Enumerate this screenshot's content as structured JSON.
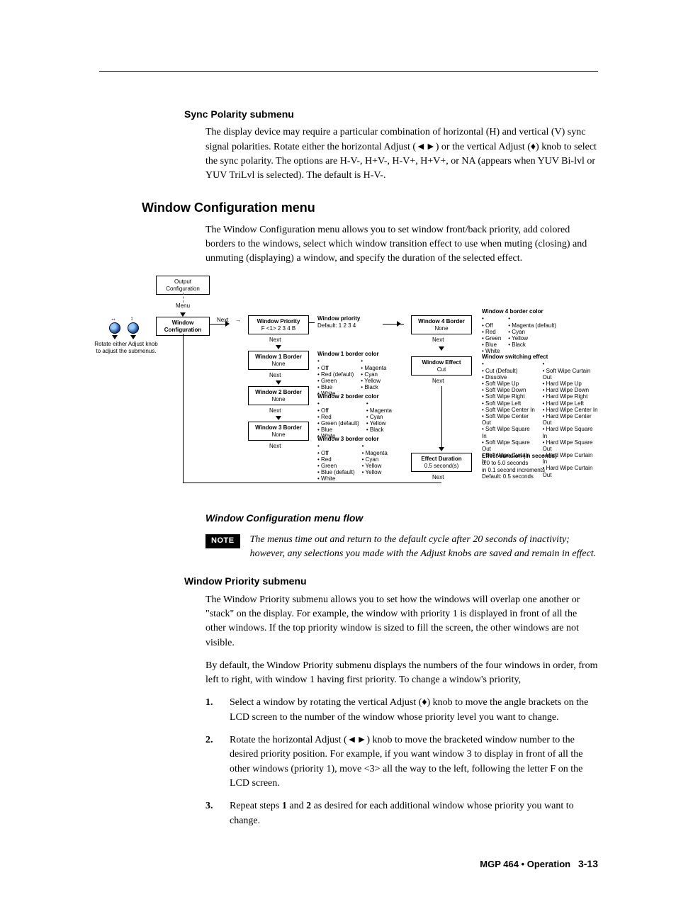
{
  "sync": {
    "heading": "Sync Polarity submenu",
    "p1": "The display device may require a particular combination of horizontal (H) and vertical (V) sync signal polarities.  Rotate either the horizontal Adjust (◄►) or the vertical Adjust (♦) knob to select the sync polarity.  The options are H-V-, H+V-, H-V+, H+V+, or NA (appears when YUV Bi-lvl or YUV TriLvl is selected).  The default is H-V-."
  },
  "wcfg": {
    "heading": "Window Configuration menu",
    "p1": "The Window Configuration menu allows you to set window front/back priority, add colored borders to the windows, select which window transition effect to use when muting (closing) and unmuting (displaying) a window, and specify the duration of the selected effect.",
    "flow_caption": "Window Configuration menu flow",
    "note_label": "NOTE",
    "note_text": "The menus time out and return to the default cycle after 20 seconds of inactivity; however, any selections you made with the Adjust knobs are saved and remain in effect."
  },
  "diagram": {
    "output_cfg": "Output\nConfiguration",
    "menu_label": "Menu",
    "window_cfg": "Window\nConfiguration",
    "next": "Next",
    "rotate_note": "Rotate either Adjust knob\nto adjust the submenus.",
    "wp_box": {
      "t": "Window Priority",
      "b": "F <1>  2  3  4  B"
    },
    "wp_side": {
      "t": "Window priority",
      "b": "Default:  1  2  3  4"
    },
    "w1b": {
      "t": "Window 1 Border",
      "b": "None"
    },
    "w2b": {
      "t": "Window 2 Border",
      "b": "None"
    },
    "w3b": {
      "t": "Window 3 Border",
      "b": "None"
    },
    "w4b": {
      "t": "Window 4 Border",
      "b": "None"
    },
    "weff": {
      "t": "Window Effect",
      "b": "Cut"
    },
    "edur": {
      "t": "Effect Duration",
      "b": "0.5 second(s)"
    },
    "bc1_title": "Window 1 border color",
    "bc2_title": "Window 2 border color",
    "bc3_title": "Window 3 border color",
    "bc4_title": "Window 4 border color",
    "bc_left": [
      "Off",
      "Red",
      "Green",
      "Blue",
      "White"
    ],
    "bc_right": [
      "Magenta",
      "Cyan",
      "Yellow",
      "Black"
    ],
    "bc1_default": "Red (default)",
    "bc2_default": "Green (default)",
    "bc3_default": "Blue (default)",
    "bc4_default": "Magenta (default)",
    "ws_title": "Window switching effect",
    "ws_left": [
      "Cut (Default)",
      "Dissolve",
      "Soft Wipe Up",
      "Soft Wipe Down",
      "Soft Wipe Right",
      "Soft Wipe Left",
      "Soft Wipe Center In",
      "Soft Wipe Center Out",
      "Soft Wipe Square In",
      "Soft Wipe Square Out",
      "Soft Wipe Curtain In"
    ],
    "ws_right": [
      "Soft Wipe Curtain Out",
      "Hard Wipe Up",
      "Hard Wipe Down",
      "Hard Wipe Right",
      "Hard Wipe Left",
      "Hard Wipe Center In",
      "Hard Wipe Center Out",
      "Hard Wipe Square In",
      "Hard Wipe Square Out",
      "Hard Wipe Curtain In",
      "Hard Wipe Curtain Out"
    ],
    "ed_title": "Effect duration (in seconds)",
    "ed_lines": [
      "0.0 to 5.0 seconds",
      "in 0.1 second increments",
      "Default: 0.5 seconds"
    ]
  },
  "wpri": {
    "heading": "Window Priority submenu",
    "p1": "The Window Priority submenu allows you to set how the windows will overlap one another or \"stack\" on the display.  For example, the window with priority 1 is displayed in front of all the other windows.  If the top priority window is sized to fill the screen, the other windows are not visible.",
    "p2": "By default, the Window Priority submenu displays the numbers of the four windows in order, from left to right, with window 1 having first priority.  To change a window's priority,",
    "steps": [
      "Select a window by rotating the vertical Adjust (♦) knob to move the angle brackets on the LCD screen to the number of the window whose priority level you want to change.",
      "Rotate the horizontal Adjust (◄►) knob to move the bracketed window number to the desired priority position.  For example, if you want window 3 to display in front of all the other windows (priority 1), move <3> all the way to the left, following the letter F on the LCD screen.",
      "Repeat steps 1 and 2 as desired for each additional window whose priority you want to change."
    ],
    "step3_display": "Repeat steps <b>1</b> and <b>2</b> as desired for each additional window whose priority you want to change."
  },
  "footer": {
    "title": "MGP 464 • Operation",
    "page": "3-13"
  }
}
